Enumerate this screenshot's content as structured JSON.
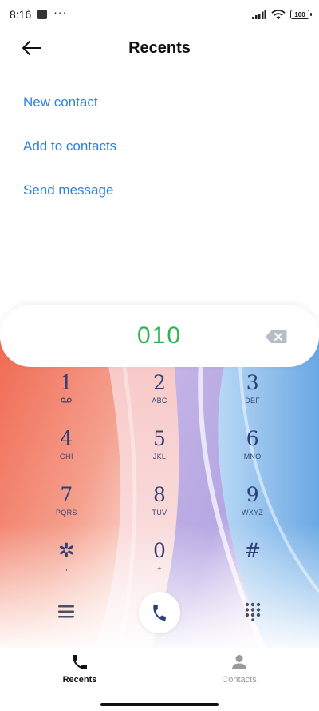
{
  "status_bar": {
    "time": "8:16",
    "more_dots": "···",
    "battery": "100"
  },
  "header": {
    "title": "Recents"
  },
  "actions": [
    {
      "label": "New contact"
    },
    {
      "label": "Add to contacts"
    },
    {
      "label": "Send message"
    }
  ],
  "dialer": {
    "number": "010",
    "keys": [
      {
        "digit": "1",
        "letters": "",
        "icon": "voicemail-icon"
      },
      {
        "digit": "2",
        "letters": "ABC"
      },
      {
        "digit": "3",
        "letters": "DEF"
      },
      {
        "digit": "4",
        "letters": "GHI"
      },
      {
        "digit": "5",
        "letters": "JKL"
      },
      {
        "digit": "6",
        "letters": "MNO"
      },
      {
        "digit": "7",
        "letters": "PQRS"
      },
      {
        "digit": "8",
        "letters": "TUV"
      },
      {
        "digit": "9",
        "letters": "WXYZ"
      },
      {
        "digit": "✲",
        "letters": "،"
      },
      {
        "digit": "0",
        "letters": "+"
      },
      {
        "digit": "#",
        "letters": ""
      }
    ]
  },
  "tabs": [
    {
      "label": "Recents",
      "icon": "phone-icon",
      "active": true
    },
    {
      "label": "Contacts",
      "icon": "person-icon",
      "active": false
    }
  ],
  "colors": {
    "accent_link": "#2f7fe0",
    "number_green": "#2fb34f",
    "key_text": "#2e3f77"
  }
}
